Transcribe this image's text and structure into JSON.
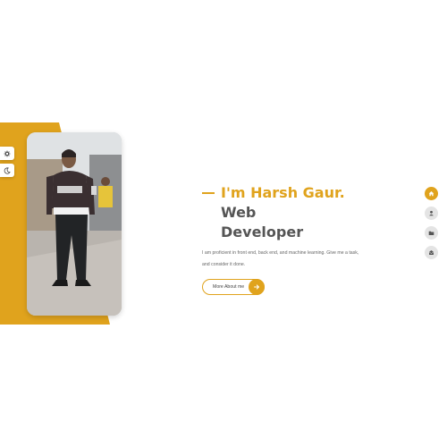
{
  "hero": {
    "greeting": "I'm Harsh Gaur.",
    "role": "Web",
    "role_line2": "Developer",
    "description_line1": "I am proficient in front end, back end, and machine learning. Give me a task,",
    "description_line2": "and consider it done.",
    "cta_label": "More About me"
  },
  "side_tools": [
    "gear-icon",
    "moon-icon"
  ],
  "right_nav": [
    {
      "icon": "home-icon",
      "active": true
    },
    {
      "icon": "user-icon",
      "active": false
    },
    {
      "icon": "folder-icon",
      "active": false
    },
    {
      "icon": "contact-icon",
      "active": false
    }
  ],
  "colors": {
    "accent": "#e0a31d",
    "title_gray": "#555555",
    "nav_inactive": "#e4e4e4"
  }
}
